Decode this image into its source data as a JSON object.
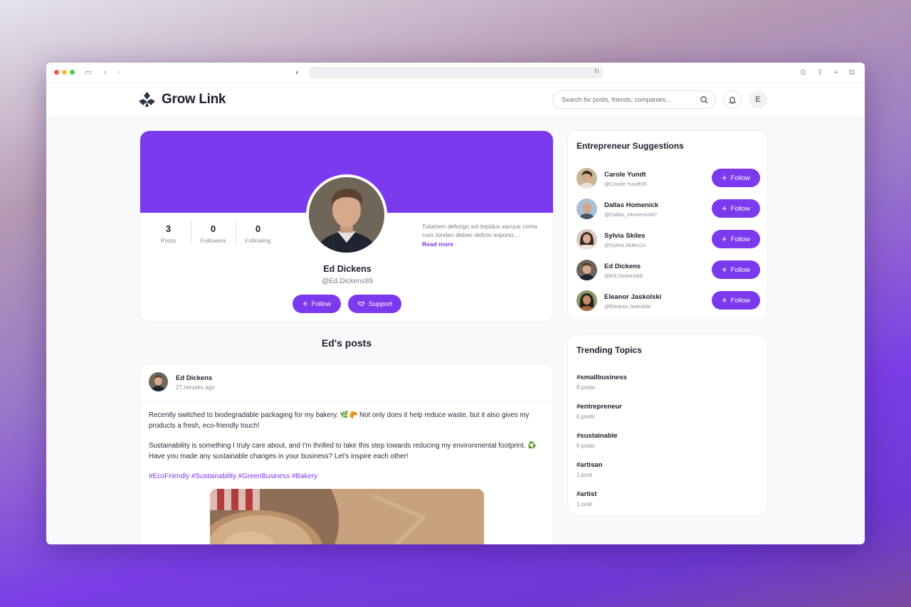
{
  "app": {
    "name": "Grow Link"
  },
  "header": {
    "search_placeholder": "Search for posts, friends, companies...",
    "avatar_initial": "E"
  },
  "profile": {
    "name": "Ed Dickens",
    "handle": "@Ed.Dickens89",
    "stats": [
      {
        "value": "3",
        "label": "Posts"
      },
      {
        "value": "0",
        "label": "Followers"
      },
      {
        "value": "0",
        "label": "Following"
      }
    ],
    "bio": "Tutamen defungo sol tepidus vacuus coma curo tondeo debeo deficio asporto....",
    "read_more": "Read more",
    "follow_label": "Follow",
    "support_label": "Support"
  },
  "posts_title": "Ed's posts",
  "post": {
    "author": "Ed Dickens",
    "time": "27 minutes ago",
    "paragraph1": "Recently switched to biodegradable packaging for my bakery. 🌿🥐 Not only does it help reduce waste, but it also gives my products a fresh, eco-friendly touch!",
    "paragraph2": "Sustainability is something I truly care about, and I'm thrilled to take this step towards reducing my environmental footprint. ♻️ Have you made any sustainable changes in your business? Let's inspire each other!",
    "tags": "#EcoFriendly #Sustainability #GreenBusiness #Bakery"
  },
  "suggestions": {
    "title": "Entrepreneur Suggestions",
    "follow_label": "Follow",
    "items": [
      {
        "name": "Carole Yundt",
        "handle": "@Carole.Yundt39"
      },
      {
        "name": "Dallas Homenick",
        "handle": "@Dallas_Homenick87"
      },
      {
        "name": "Sylvia Skiles",
        "handle": "@Sylvia.Skiles13"
      },
      {
        "name": "Ed Dickens",
        "handle": "@Ed.Dickens89"
      },
      {
        "name": "Eleanor Jaskolski",
        "handle": "@Eleanor.Jaskolski"
      }
    ]
  },
  "trending": {
    "title": "Trending Topics",
    "items": [
      {
        "tag": "#smallbusiness",
        "count": "8 posts"
      },
      {
        "tag": "#entrepreneur",
        "count": "6 posts"
      },
      {
        "tag": "#sustainable",
        "count": "6 posts"
      },
      {
        "tag": "#artisan",
        "count": "1 post"
      },
      {
        "tag": "#artist",
        "count": "1 post"
      }
    ]
  },
  "colors": {
    "accent": "#7b3aed",
    "text": "#1b1f2a",
    "muted": "#8a8d96"
  }
}
